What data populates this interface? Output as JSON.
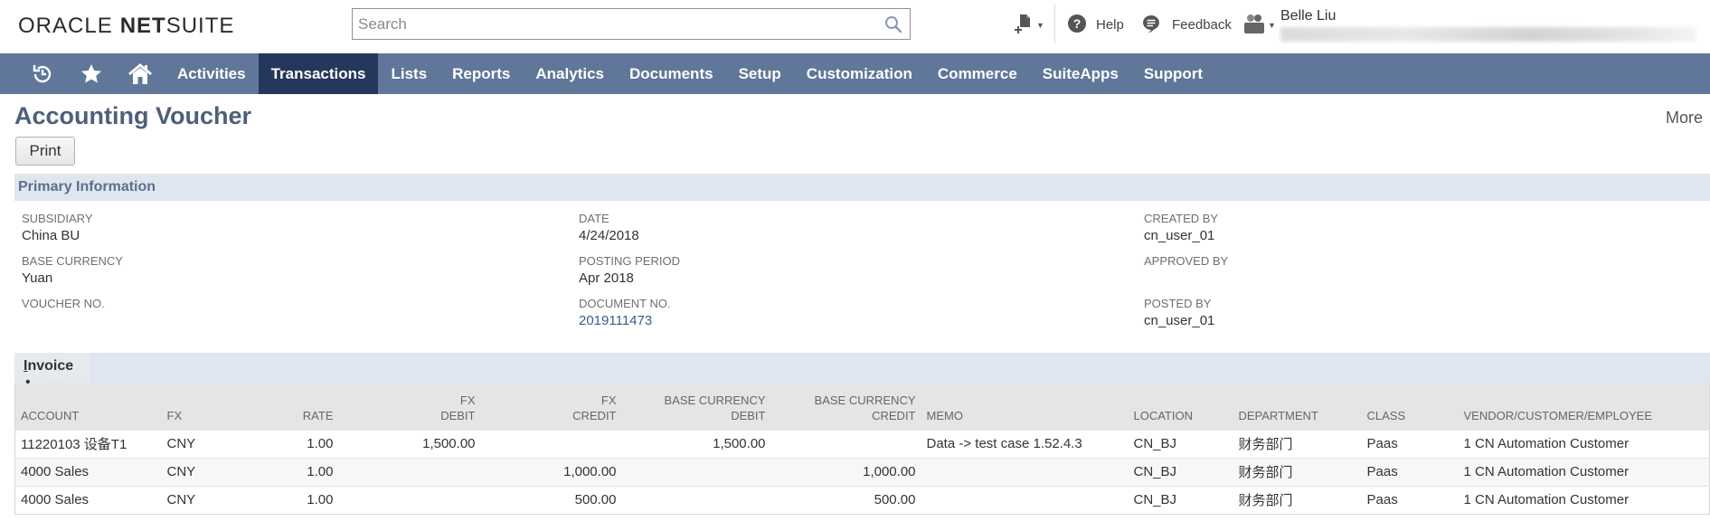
{
  "header": {
    "logo_oracle": "ORACLE",
    "logo_net": "NET",
    "logo_suite": "SUITE",
    "search_placeholder": "Search",
    "help_label": "Help",
    "feedback_label": "Feedback",
    "user_name": "Belle Liu"
  },
  "nav": {
    "items": [
      {
        "label": "Activities"
      },
      {
        "label": "Transactions",
        "active": true
      },
      {
        "label": "Lists"
      },
      {
        "label": "Reports"
      },
      {
        "label": "Analytics"
      },
      {
        "label": "Documents"
      },
      {
        "label": "Setup"
      },
      {
        "label": "Customization"
      },
      {
        "label": "Commerce"
      },
      {
        "label": "SuiteApps"
      },
      {
        "label": "Support"
      }
    ]
  },
  "page": {
    "title": "Accounting Voucher",
    "more_label": "More",
    "print_label": "Print"
  },
  "primary": {
    "section_label": "Primary Information",
    "fields": {
      "subsidiary": {
        "label": "SUBSIDIARY",
        "value": "China BU"
      },
      "base_currency": {
        "label": "BASE CURRENCY",
        "value": "Yuan"
      },
      "voucher_no": {
        "label": "VOUCHER NO.",
        "value": ""
      },
      "date": {
        "label": "DATE",
        "value": "4/24/2018"
      },
      "posting_period": {
        "label": "POSTING PERIOD",
        "value": "Apr 2018"
      },
      "document_no": {
        "label": "DOCUMENT NO.",
        "value": "2019111473"
      },
      "created_by": {
        "label": "CREATED BY",
        "value": "cn_user_01"
      },
      "approved_by": {
        "label": "APPROVED BY",
        "value": ""
      },
      "posted_by": {
        "label": "POSTED BY",
        "value": "cn_user_01"
      }
    }
  },
  "invoice": {
    "tab_letter": "I",
    "tab_rest": "nvoice",
    "tab_dot": "•",
    "columns": {
      "account": "ACCOUNT",
      "fx": "FX",
      "rate": "RATE",
      "fx_debit_1": "FX",
      "fx_debit_2": "DEBIT",
      "fx_credit_1": "FX",
      "fx_credit_2": "CREDIT",
      "base_debit_1": "BASE CURRENCY",
      "base_debit_2": "DEBIT",
      "base_credit_1": "BASE CURRENCY",
      "base_credit_2": "CREDIT",
      "memo": "MEMO",
      "location": "LOCATION",
      "department": "DEPARTMENT",
      "class": "CLASS",
      "vendor": "VENDOR/CUSTOMER/EMPLOYEE"
    },
    "rows": [
      {
        "account": "11220103 设备T1",
        "fx": "CNY",
        "rate": "1.00",
        "fx_debit": "1,500.00",
        "fx_credit": "",
        "base_debit": "1,500.00",
        "base_credit": "",
        "memo": "Data -> test case 1.52.4.3",
        "location": "CN_BJ",
        "department": "财务部门",
        "class": "Paas",
        "vendor": "1 CN Automation Customer"
      },
      {
        "account": "4000 Sales",
        "fx": "CNY",
        "rate": "1.00",
        "fx_debit": "",
        "fx_credit": "1,000.00",
        "base_debit": "",
        "base_credit": "1,000.00",
        "memo": "",
        "location": "CN_BJ",
        "department": "财务部门",
        "class": "Paas",
        "vendor": "1 CN Automation Customer"
      },
      {
        "account": "4000 Sales",
        "fx": "CNY",
        "rate": "1.00",
        "fx_debit": "",
        "fx_credit": "500.00",
        "base_debit": "",
        "base_credit": "500.00",
        "memo": "",
        "location": "CN_BJ",
        "department": "财务部门",
        "class": "Paas",
        "vendor": "1 CN Automation Customer"
      }
    ]
  },
  "colors": {
    "nav_bg": "#607799",
    "nav_active": "#25385b",
    "title": "#4d5f79",
    "section_bg": "#e0e6ef",
    "link": "#3a5c8f"
  }
}
